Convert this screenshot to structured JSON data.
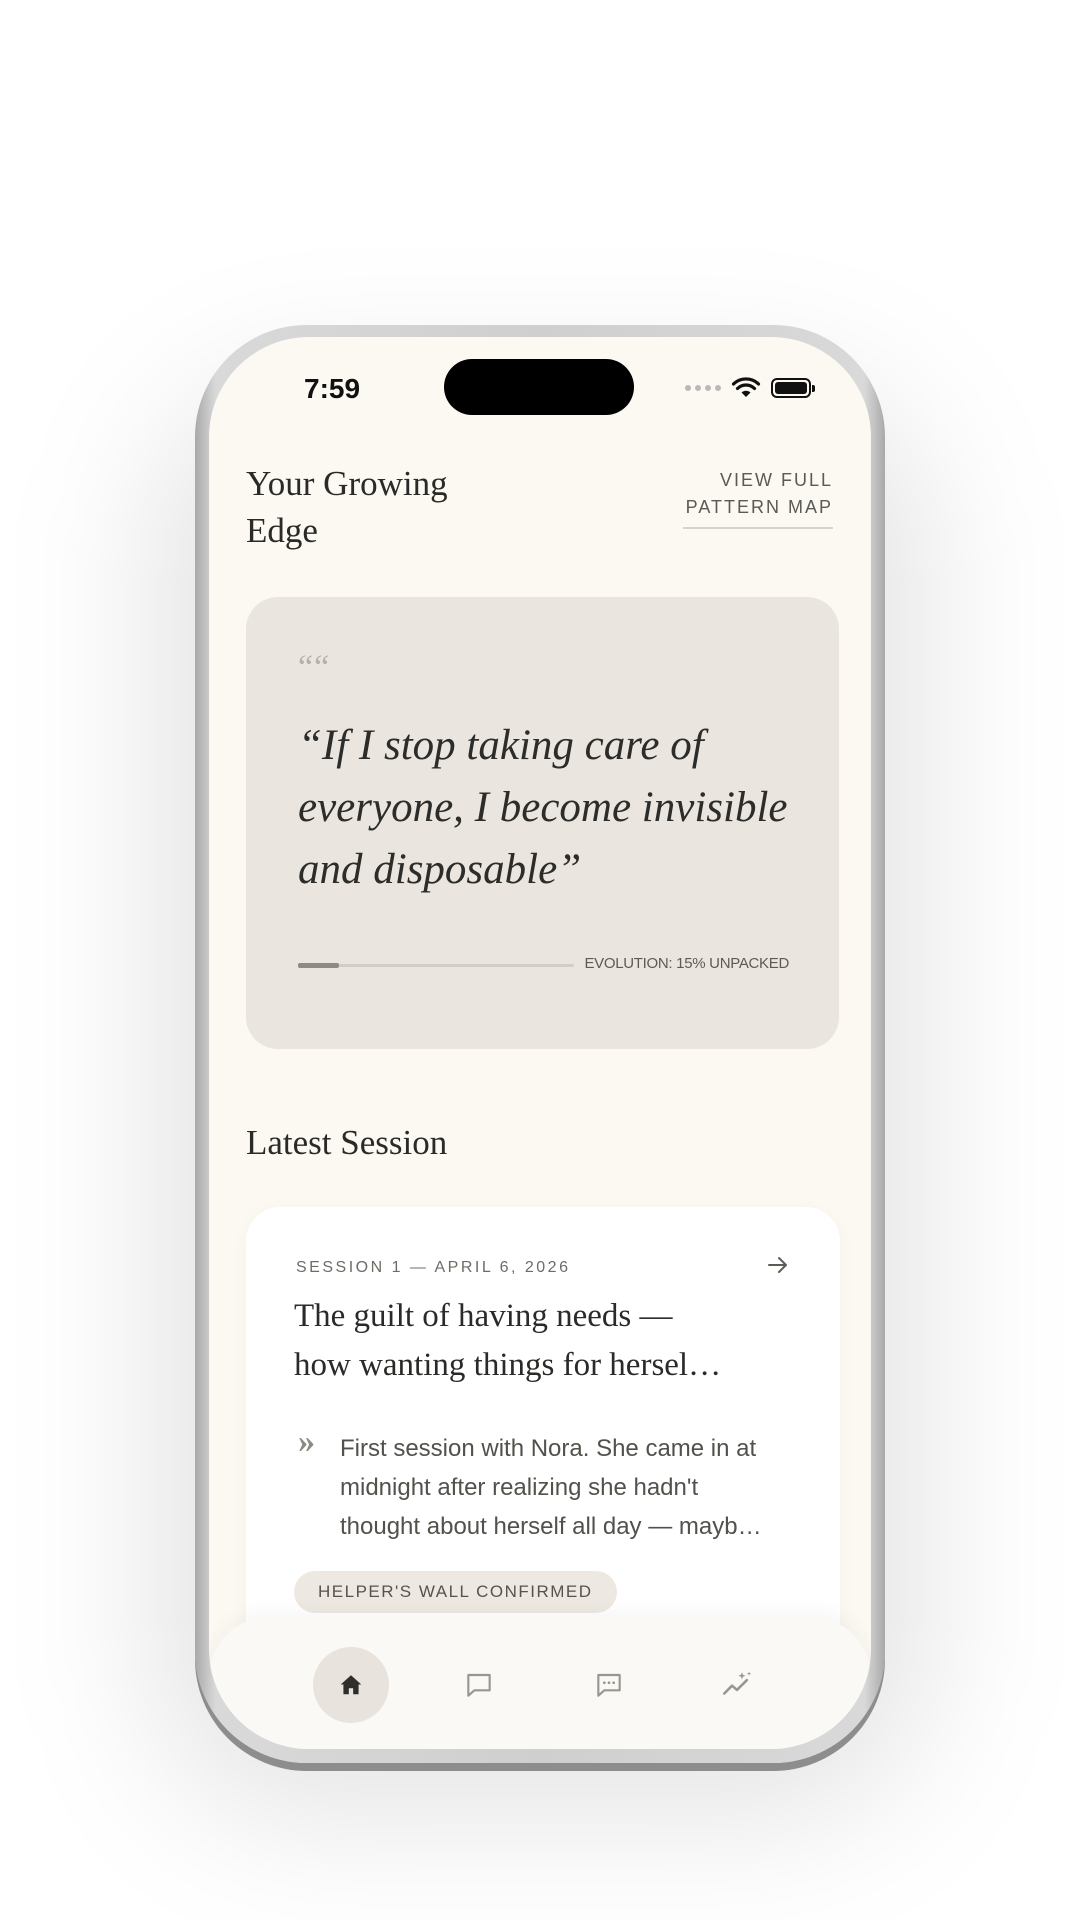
{
  "status_bar": {
    "time": "7:59"
  },
  "growing_edge": {
    "title": "Your Growing Edge",
    "link_label": "VIEW FULL PATTERN MAP"
  },
  "quote_card": {
    "quote_mark": "““",
    "quote": "“If I stop taking care of everyone, I become invisible and disposable”",
    "progress_percent": 15,
    "evolution_label": "EVOLUTION: 15% UNPACKED"
  },
  "latest_session": {
    "title": "Latest Session",
    "card": {
      "meta": "SESSION 1 — APRIL 6, 2026",
      "title_lines": [
        "The guilt of having needs —",
        "how wanting things for hersel…"
      ],
      "summary_mark": "»",
      "summary_lines": [
        "First session with Nora. She came in at",
        "midnight after realizing she hadn't",
        "thought about herself all day — mayb…"
      ],
      "tag": "HELPER'S WALL CONFIRMED"
    }
  },
  "bottom_nav": {
    "items": [
      {
        "icon": "home-icon",
        "active": true
      },
      {
        "icon": "chat-bubble-icon",
        "active": false
      },
      {
        "icon": "messages-icon",
        "active": false
      },
      {
        "icon": "insights-icon",
        "active": false
      }
    ]
  },
  "colors": {
    "background": "#fcf8f2",
    "card_quote": "#eae6df",
    "card_session": "#ffffff",
    "text_primary": "#2a2a28",
    "accent_progress": "#8f8b84"
  }
}
